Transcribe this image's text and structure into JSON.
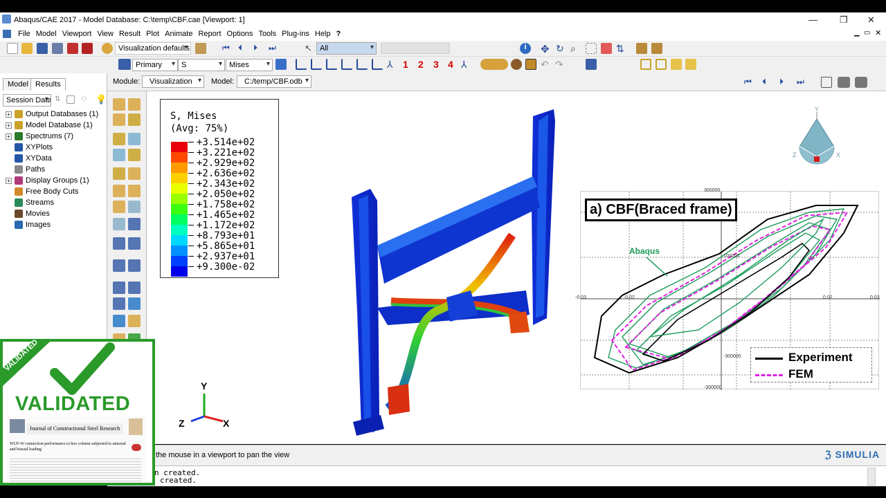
{
  "window": {
    "title": "Abaqus/CAE 2017 - Model Database: C:\\temp\\CBF.cae [Viewport: 1]"
  },
  "menu": [
    "File",
    "Model",
    "Viewport",
    "View",
    "Result",
    "Plot",
    "Animate",
    "Report",
    "Options",
    "Tools",
    "Plug-ins",
    "Help",
    "?"
  ],
  "toolbar": {
    "visualization_defaults": "Visualization defaults",
    "selection_filter": "All",
    "output_primary": "Primary",
    "output_variable": "S",
    "output_component": "Mises",
    "numbers": [
      "1",
      "2",
      "3",
      "4"
    ]
  },
  "context": {
    "module_label": "Module:",
    "module_value": "Visualization",
    "model_label": "Model:",
    "model_value": "C:/temp/CBF.odb"
  },
  "tabs": {
    "model": "Model",
    "results": "Results"
  },
  "session_data": "Session Data",
  "tree": [
    {
      "label": "Output Databases (1)",
      "expand": true,
      "color": "#c9a227"
    },
    {
      "label": "Model Database (1)",
      "expand": true,
      "color": "#c9a227"
    },
    {
      "label": "Spectrums (7)",
      "expand": true,
      "color": "#2a7a2a"
    },
    {
      "label": "XYPlots",
      "expand": false,
      "color": "#2457a8"
    },
    {
      "label": "XYData",
      "expand": false,
      "color": "#2457a8"
    },
    {
      "label": "Paths",
      "expand": false,
      "color": "#888888"
    },
    {
      "label": "Display Groups (1)",
      "expand": true,
      "color": "#b0397a"
    },
    {
      "label": "Free Body Cuts",
      "expand": false,
      "color": "#d28a2b"
    },
    {
      "label": "Streams",
      "expand": false,
      "color": "#2a8a5a"
    },
    {
      "label": "Movies",
      "expand": false,
      "color": "#6a4a2a"
    },
    {
      "label": "Images",
      "expand": false,
      "color": "#2a6ab0"
    }
  ],
  "legend": {
    "title_line1": "S, Mises",
    "title_line2": "(Avg: 75%)",
    "values": [
      "+3.514e+02",
      "+3.221e+02",
      "+2.929e+02",
      "+2.636e+02",
      "+2.343e+02",
      "+2.050e+02",
      "+1.758e+02",
      "+1.465e+02",
      "+1.172e+02",
      "+8.793e+01",
      "+5.865e+01",
      "+2.937e+01",
      "+9.300e-02"
    ],
    "colors": [
      "#e8000b",
      "#ff4a00",
      "#ff9a00",
      "#ffd000",
      "#e8ff00",
      "#9aff00",
      "#3cff10",
      "#00ff60",
      "#00ffc0",
      "#00d8ff",
      "#0090ff",
      "#0040ff",
      "#0000e8"
    ]
  },
  "triad": {
    "y": "Y",
    "z": "Z",
    "x": "X"
  },
  "viewcube": {
    "y": "Y",
    "z": "Z",
    "x": "X"
  },
  "graph": {
    "title": "a) CBF(Braced frame)",
    "annotation": "Abaqus",
    "xticks": [
      "-0.03",
      "-0.02",
      "0.02",
      "0.03"
    ],
    "yticks": [
      "300000",
      "100000",
      "-300000",
      "-300000"
    ],
    "legend": [
      {
        "label": "Experiment",
        "color": "#000000",
        "style": "solid"
      },
      {
        "label": "FEM",
        "color": "#e020e0",
        "style": "dashed"
      }
    ]
  },
  "message": "the mouse in a viewport to pan the view",
  "console": [
    "n created.",
    "created."
  ],
  "brand": "SIMULIA",
  "validated": {
    "badge": "VALIDATED",
    "heading": "VALIDATED",
    "journal": "Journal of Constructional Steel Research",
    "article_title": "WUF-W connection performance to box column subjected to uniaxial and biaxial loading"
  }
}
